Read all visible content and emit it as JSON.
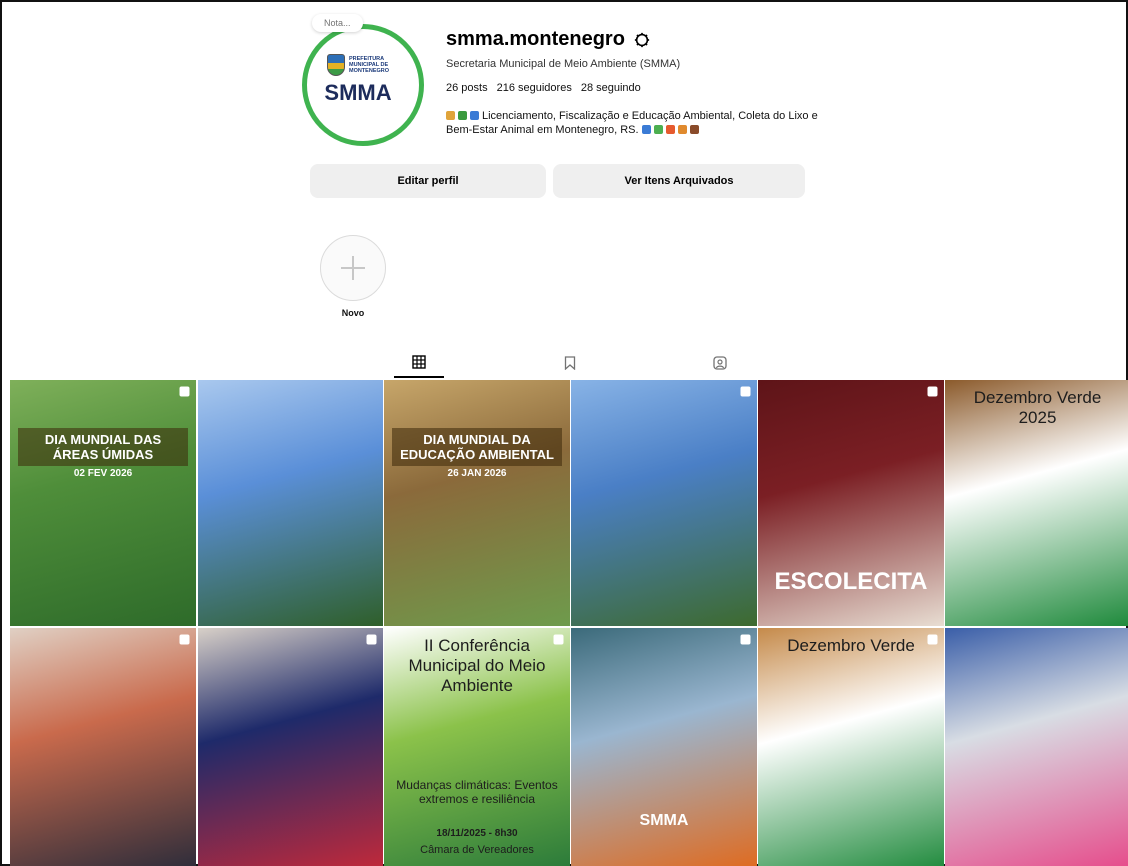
{
  "profile": {
    "nota_label": "Nota...",
    "avatar_prefeitura_text": "PREFEITURA\nMUNICIPAL DE\nMONTENEGRO",
    "avatar_logo_text": "SMMA",
    "username": "smma.montenegro",
    "full_name": "Secretaria Municipal de Meio Ambiente (SMMA)",
    "stats": {
      "posts": "26 posts",
      "followers": "216 seguidores",
      "following": "28 seguindo"
    },
    "bio_line1": "Licenciamento, Fiscalização e Educação Ambiental, Coleta do Lixo e",
    "bio_line2": "Bem-Estar Animal em Montenegro, RS.",
    "emoji_colors_1": [
      "#e0a43a",
      "#3a9a3e",
      "#3a7bd5"
    ],
    "emoji_colors_2": [
      "#3a7bd5",
      "#4caf50",
      "#e65a2e",
      "#e08a2e",
      "#8a4b2a"
    ]
  },
  "buttons": {
    "edit_profile": "Editar perfil",
    "view_archive": "Ver Itens Arquivados"
  },
  "highlights": {
    "new_label": "Novo"
  },
  "tabs": [
    "posts",
    "saved",
    "tagged"
  ],
  "posts": [
    {
      "title": "DIA MUNDIAL DAS ÁREAS ÚMIDAS",
      "date": "02 FEV 2026",
      "multi": true,
      "colors": [
        "#4f8e3a",
        "#2e6b2a",
        "#7fb05a"
      ]
    },
    {
      "title": "",
      "date": "",
      "multi": false,
      "colors": [
        "#5a8fd8",
        "#2f5f2a",
        "#a9c8ee"
      ]
    },
    {
      "title": "DIA MUNDIAL DA EDUCAÇÃO AMBIENTAL",
      "date": "26 JAN 2026",
      "multi": false,
      "colors": [
        "#8b6a3b",
        "#6e9b4c",
        "#c7a66a"
      ]
    },
    {
      "title": "",
      "date": "",
      "multi": true,
      "colors": [
        "#4a7fc6",
        "#3d6a2e",
        "#88b3e6"
      ]
    },
    {
      "title": "ESCOLECITA",
      "date": "",
      "multi": true,
      "colors": [
        "#7b1f24",
        "#e8ddd2",
        "#5e1418"
      ]
    },
    {
      "title": "Dezembro Verde 2025",
      "date": "",
      "multi": false,
      "colors": [
        "#ffffff",
        "#1f8a3c",
        "#8b5a2b"
      ]
    },
    {
      "title": "",
      "date": "",
      "multi": true,
      "colors": [
        "#c96a4c",
        "#2c2c3a",
        "#e0d0c4"
      ]
    },
    {
      "title": "",
      "date": "",
      "multi": true,
      "colors": [
        "#1e2a6a",
        "#c2293a",
        "#d8d0c8"
      ]
    },
    {
      "title": "II Conferência Municipal do Meio Ambiente",
      "subtitle": "Mudanças climáticas: Eventos extremos e resiliência",
      "date": "18/11/2025 - 8h30",
      "place": "Câmara de Vereadores",
      "multi": true,
      "colors": [
        "#8bc24a",
        "#2a7a3a",
        "#ffffff"
      ]
    },
    {
      "title": "SMMA",
      "date": "",
      "multi": true,
      "colors": [
        "#9ab6d0",
        "#e06a1e",
        "#3b6a7a"
      ]
    },
    {
      "title": "Dezembro Verde",
      "date": "",
      "multi": true,
      "colors": [
        "#ffffff",
        "#1f8a3c",
        "#c58a4a"
      ]
    },
    {
      "title": "",
      "date": "",
      "multi": false,
      "colors": [
        "#d8dde4",
        "#e64a8a",
        "#3a5ea8"
      ]
    }
  ]
}
